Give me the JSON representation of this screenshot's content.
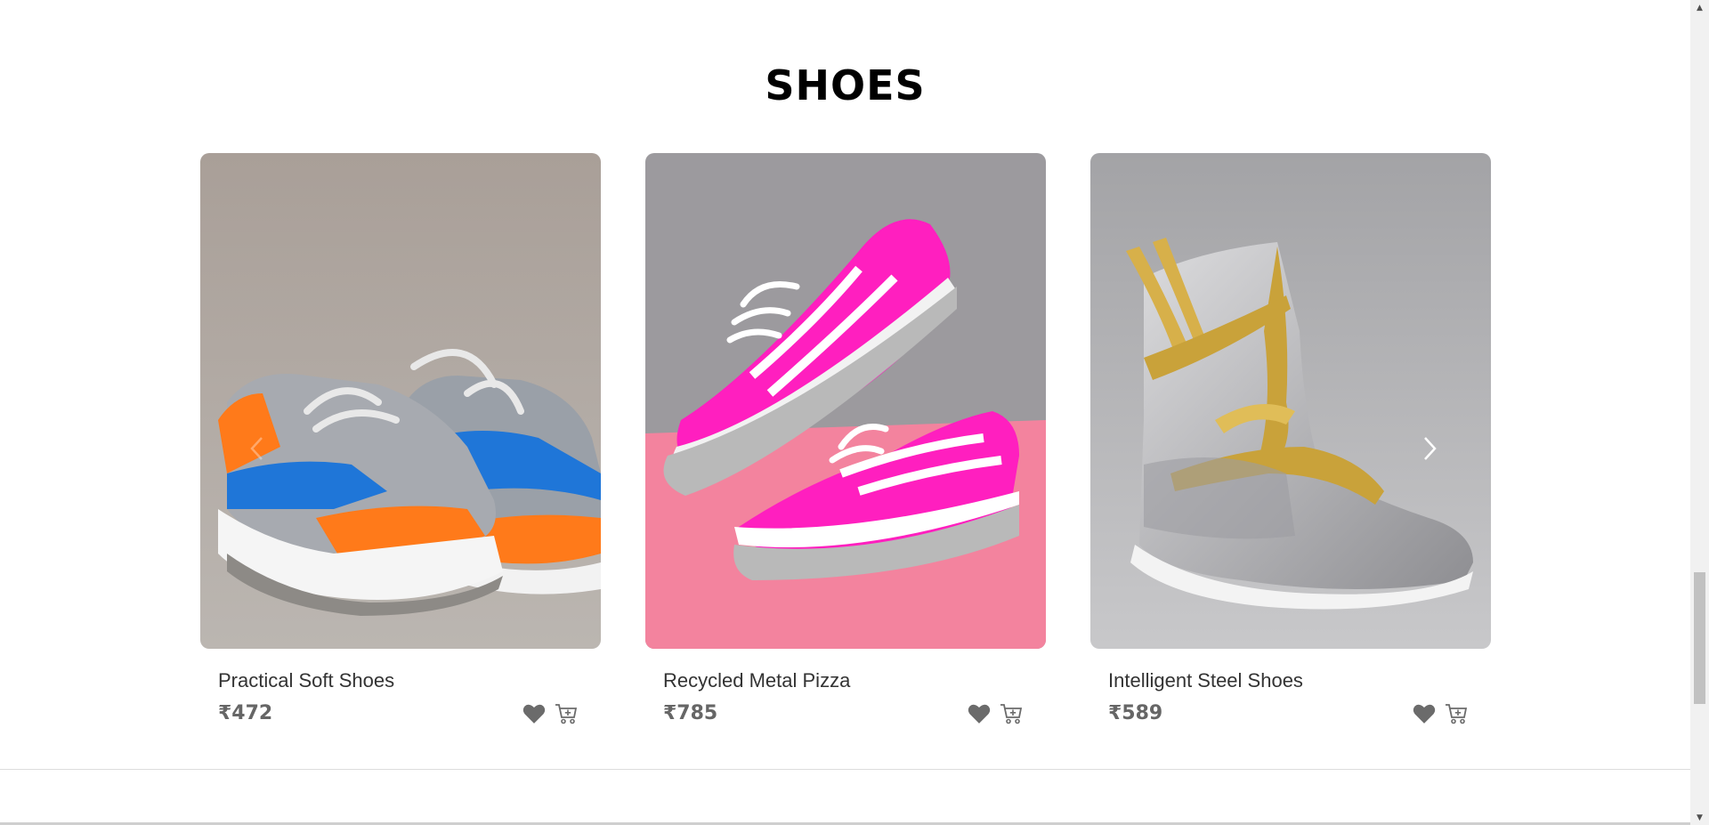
{
  "section": {
    "title": "SHOES"
  },
  "products": [
    {
      "name": "Practical Soft Shoes",
      "price": "₹472"
    },
    {
      "name": "Recycled Metal Pizza",
      "price": "₹785"
    },
    {
      "name": "Intelligent Steel Shoes",
      "price": "₹589"
    }
  ],
  "icons": {
    "wishlist": "heart-icon",
    "cart": "add-to-cart-icon",
    "prev": "chevron-left-icon",
    "next": "chevron-right-icon"
  },
  "colors": {
    "icon": "#6b6b6b",
    "price": "#666666",
    "name": "#333333"
  }
}
